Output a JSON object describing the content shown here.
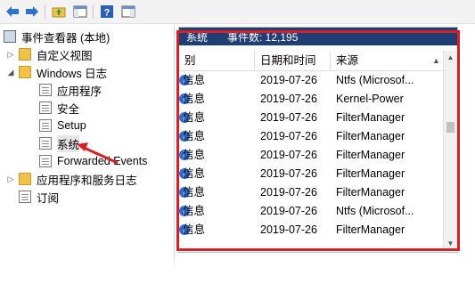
{
  "toolbar": {
    "icons": [
      "back-arrow-icon",
      "forward-arrow-icon",
      "up-folder-icon",
      "show-hide-tree-icon",
      "help-icon",
      "action-pane-icon"
    ]
  },
  "tree": {
    "root": "事件查看器 (本地)",
    "custom_views": "自定义视图",
    "windows_logs": "Windows 日志",
    "logs": [
      "应用程序",
      "安全",
      "Setup",
      "系统",
      "Forwarded Events"
    ],
    "app_service_logs": "应用程序和服务日志",
    "subscriptions": "订阅"
  },
  "grid": {
    "info_label": "系统",
    "info_count": "事件数: 12,195",
    "columns": [
      "别",
      "日期和时间",
      "来源"
    ],
    "rows": [
      {
        "level": "信息",
        "date": "2019-07-26",
        "source": "Ntfs (Microsof..."
      },
      {
        "level": "信息",
        "date": "2019-07-26",
        "source": "Kernel-Power"
      },
      {
        "level": "信息",
        "date": "2019-07-26",
        "source": "FilterManager"
      },
      {
        "level": "信息",
        "date": "2019-07-26",
        "source": "FilterManager"
      },
      {
        "level": "信息",
        "date": "2019-07-26",
        "source": "FilterManager"
      },
      {
        "level": "信息",
        "date": "2019-07-26",
        "source": "FilterManager"
      },
      {
        "level": "信息",
        "date": "2019-07-26",
        "source": "FilterManager"
      },
      {
        "level": "信息",
        "date": "2019-07-26",
        "source": "Ntfs (Microsof..."
      },
      {
        "level": "信息",
        "date": "2019-07-26",
        "source": "FilterManager"
      }
    ]
  },
  "colors": {
    "annotation_red": "#d61f26",
    "infobar_blue": "#1f3f74",
    "info_icon_blue": "#2a6ed6"
  }
}
